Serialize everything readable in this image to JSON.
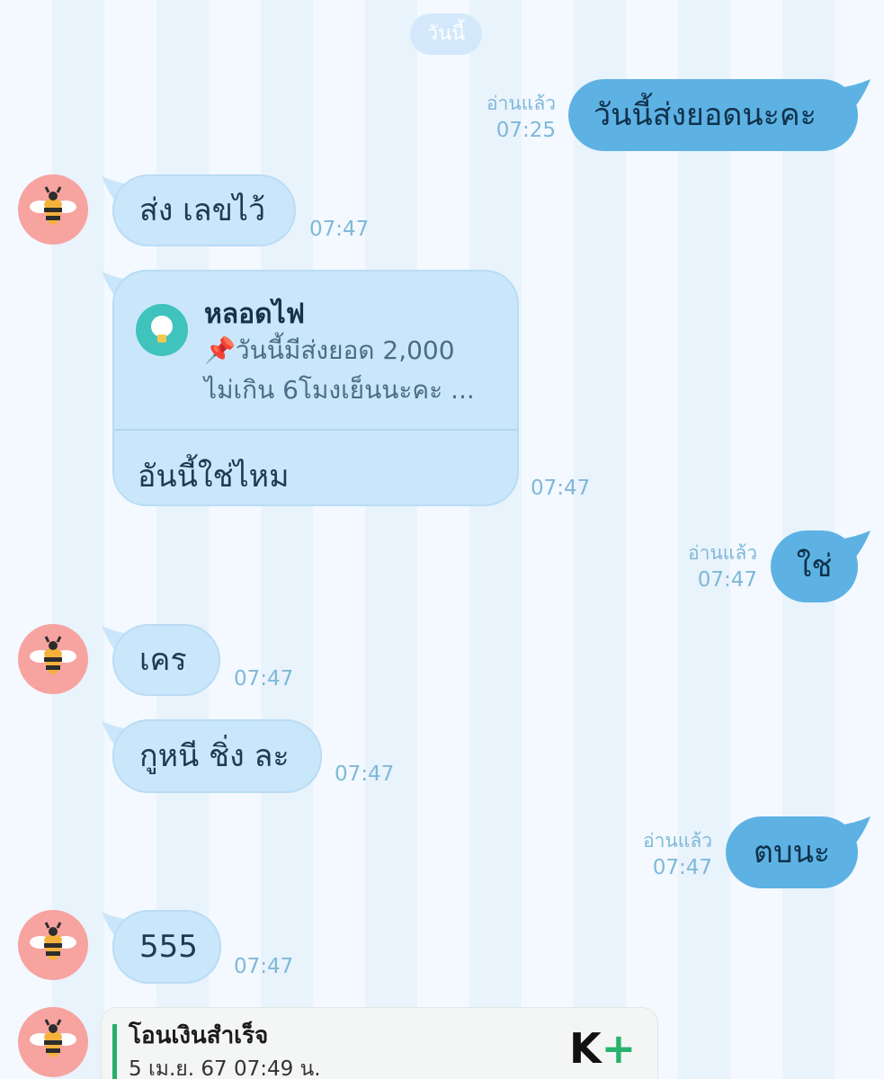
{
  "date_divider": "วันนี้",
  "read_label": "อ่านแล้ว",
  "colors": {
    "incoming_bubble": "#cae6fa",
    "outgoing_bubble": "#5db2e3",
    "timestamp": "#7fb8d8",
    "avatar_bg": "#f7a3a0",
    "reply_icon_bg": "#3fc3bc",
    "bank_accent": "#26b06b"
  },
  "messages": [
    {
      "dir": "out",
      "text": "วันนี้ส่งยอดนะคะ",
      "time": "07:25",
      "read": true
    },
    {
      "dir": "in",
      "text": "ส่ง เลขไว้",
      "time": "07:47"
    },
    {
      "dir": "in",
      "type": "reply",
      "time": "07:47",
      "quoted": {
        "sender": "หลอดไฟ",
        "icon": "lightbulb-icon",
        "line1": "📌วันนี้มีส่งยอด 2,000",
        "line2": "ไม่เกิน 6โมงเย็นนะคะ ..."
      },
      "text": "อันนี้ใช่ไหม"
    },
    {
      "dir": "out",
      "text": "ใช่",
      "time": "07:47",
      "read": true
    },
    {
      "dir": "in",
      "text": "เคร",
      "time": "07:47"
    },
    {
      "dir": "in",
      "text": "กูหนี ชิ่ง ละ",
      "time": "07:47"
    },
    {
      "dir": "out",
      "text": "ตบนะ",
      "time": "07:47",
      "read": true
    },
    {
      "dir": "in",
      "text": "555",
      "time": "07:47"
    },
    {
      "dir": "in",
      "type": "image",
      "title": "โอนเงินสำเร็จ",
      "subtitle": "5 เม.ย. 67  07:49 น.",
      "brand": "K",
      "brand_plus": "+"
    }
  ]
}
